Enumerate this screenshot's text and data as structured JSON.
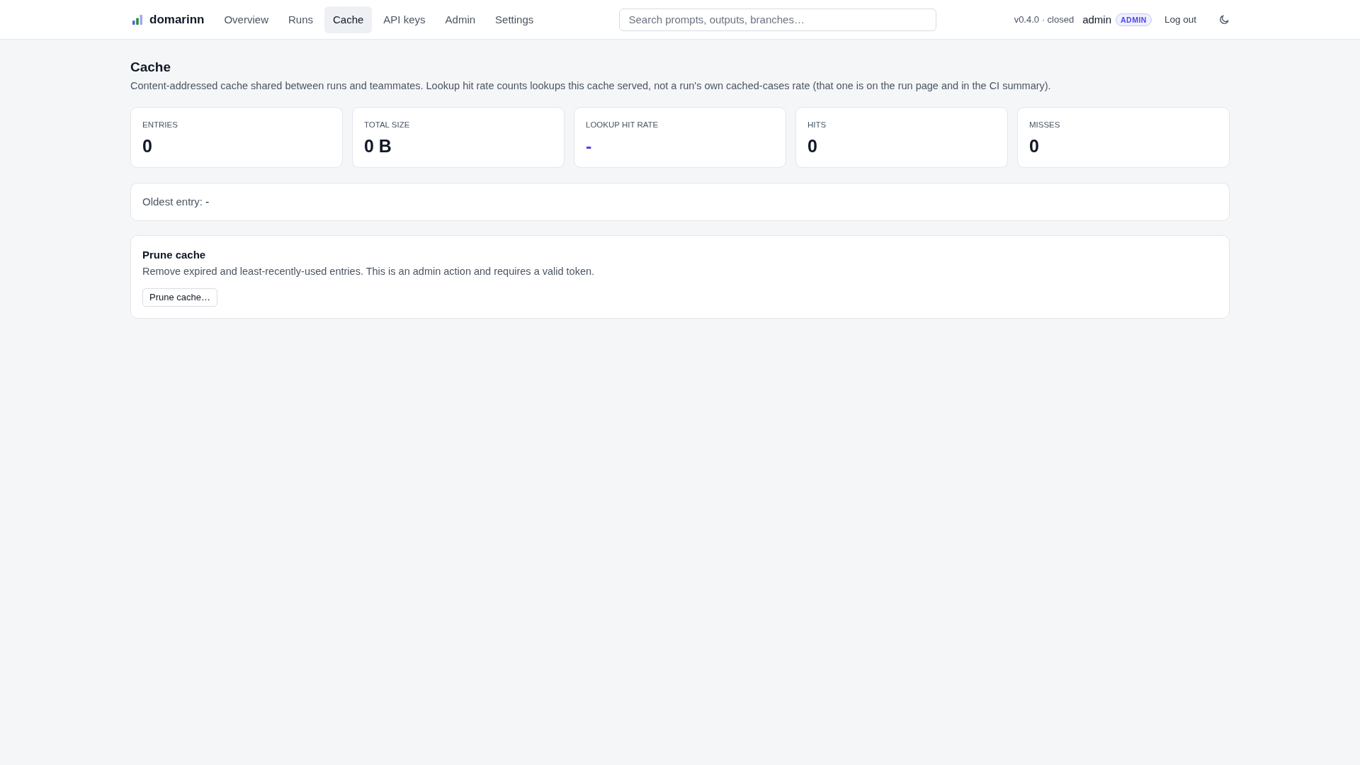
{
  "header": {
    "brand": "domarinn",
    "nav": [
      {
        "label": "Overview",
        "selected": false
      },
      {
        "label": "Runs",
        "selected": false
      },
      {
        "label": "Cache",
        "selected": true
      },
      {
        "label": "API keys",
        "selected": false
      },
      {
        "label": "Admin",
        "selected": false
      },
      {
        "label": "Settings",
        "selected": false
      }
    ],
    "search": {
      "placeholder": "Search prompts, outputs, branches…"
    },
    "version": "v0.4.0 · closed",
    "user": "admin",
    "role_badge": "ADMIN",
    "logout": "Log out"
  },
  "page": {
    "title": "Cache",
    "description": "Content-addressed cache shared between runs and teammates. Lookup hit rate counts lookups this cache served, not a run's own cached-cases rate (that one is on the run page and in the CI summary)."
  },
  "stats": [
    {
      "label": "ENTRIES",
      "value": "0",
      "color": "#111827"
    },
    {
      "label": "TOTAL SIZE",
      "value": "0 B",
      "color": "#111827"
    },
    {
      "label": "LOOKUP HIT RATE",
      "value": "-",
      "color": "#4f46e5"
    },
    {
      "label": "HITS",
      "value": "0",
      "color": "#111827"
    },
    {
      "label": "MISSES",
      "value": "0",
      "color": "#111827"
    }
  ],
  "oldest_entry": {
    "label": "Oldest entry:",
    "value": "-"
  },
  "prune": {
    "title": "Prune cache",
    "description": "Remove expired and least-recently-used entries. This is an admin action and requires a valid token.",
    "button": "Prune cache…"
  }
}
